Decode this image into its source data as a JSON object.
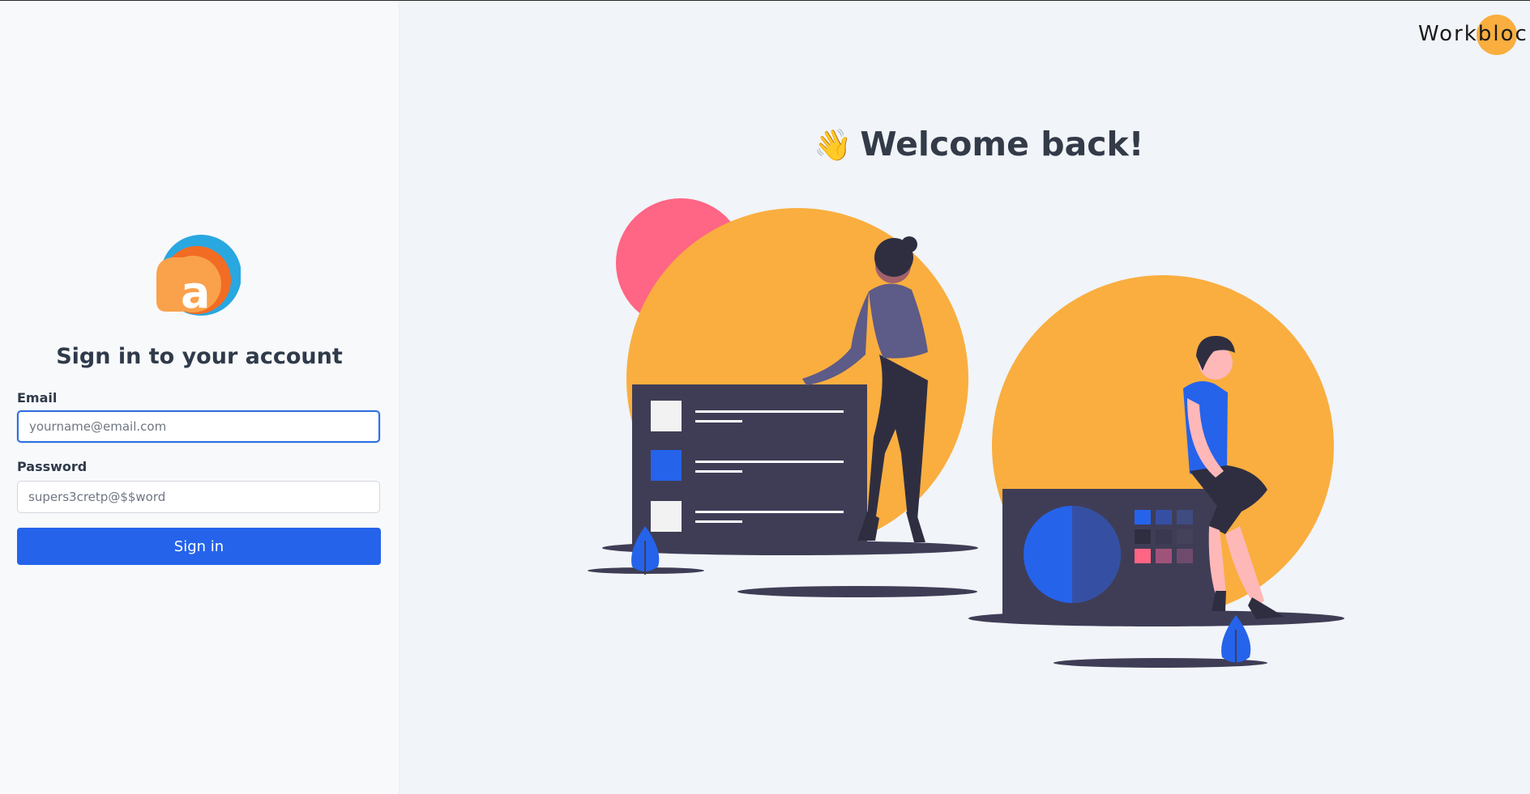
{
  "colors": {
    "primary": "#2563eb",
    "accent_orange": "#f9ae3f",
    "accent_pink": "#ff6584",
    "dark": "#3f3d56"
  },
  "logo": {
    "letter": "a"
  },
  "login": {
    "title": "Sign in to your account",
    "email_label": "Email",
    "email_placeholder": "yourname@email.com",
    "password_label": "Password",
    "password_placeholder": "supers3cretp@$$word",
    "signin_label": "Sign in"
  },
  "brand": {
    "name": "Workbloc"
  },
  "welcome": {
    "emoji": "👋",
    "text": "Welcome back!"
  },
  "illustration": {
    "icons": [
      "woman-figure",
      "man-figure",
      "dashboard-panel",
      "chart-panel",
      "plant-icon"
    ]
  }
}
